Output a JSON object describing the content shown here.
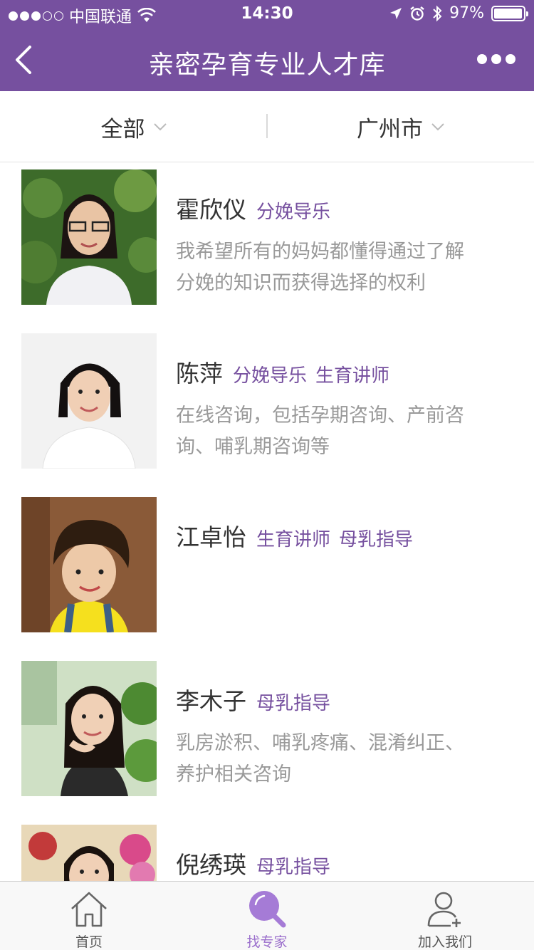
{
  "status_bar": {
    "carrier": "中国联通",
    "time": "14:30",
    "battery_percent": "97%",
    "battery_level": 0.97
  },
  "nav": {
    "title": "亲密孕育专业人才库"
  },
  "filters": {
    "category": "全部",
    "city": "广州市"
  },
  "experts": [
    {
      "name": "霍欣仪",
      "tags": [
        "分娩导乐"
      ],
      "desc_lines": [
        "我希望所有的妈妈都懂得通过了解",
        "分娩的知识而获得选择的权利"
      ]
    },
    {
      "name": "陈萍",
      "tags": [
        "分娩导乐",
        "生育讲师"
      ],
      "desc_lines": [
        "在线咨询，包括孕期咨询、产前咨",
        "询、哺乳期咨询等"
      ]
    },
    {
      "name": "江卓怡",
      "tags": [
        "生育讲师",
        "母乳指导"
      ],
      "desc_lines": []
    },
    {
      "name": "李木子",
      "tags": [
        "母乳指导"
      ],
      "desc_lines": [
        "乳房淤积、哺乳疼痛、混淆纠正、",
        "养护相关咨询"
      ]
    },
    {
      "name": "倪绣瑛",
      "tags": [
        "母乳指导"
      ],
      "desc_lines": []
    }
  ],
  "tabbar": {
    "home": "首页",
    "find_expert": "找专家",
    "join_us": "加入我们",
    "active": "find_expert"
  },
  "colors": {
    "brand": "#76509f",
    "tab_active": "#9b6fcc",
    "tag": "#76509f"
  }
}
